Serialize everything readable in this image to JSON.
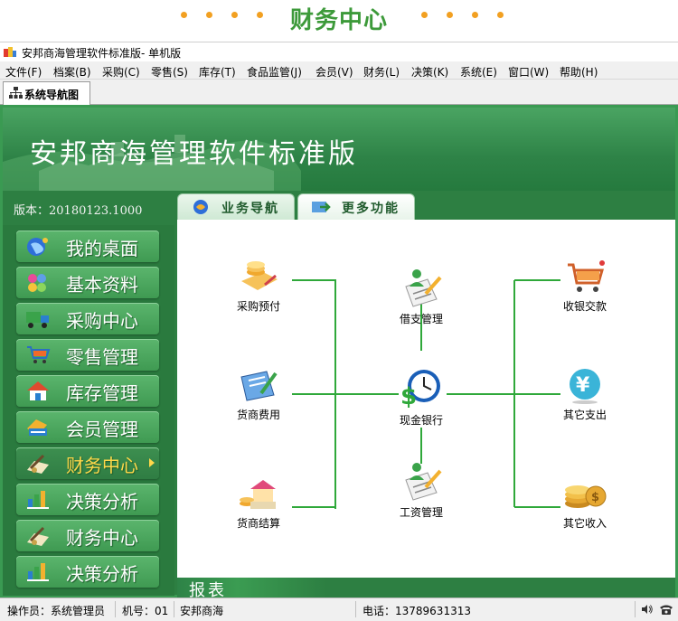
{
  "banner": {
    "title": "财务中心"
  },
  "window": {
    "title": "安邦商海管理软件标准版- 单机版"
  },
  "menu": [
    "文件(F)",
    "档案(B)",
    "采购(C)",
    "零售(S)",
    "库存(T)",
    "食品监管(J)",
    "会员(V)",
    "财务(L)",
    "决策(K)",
    "系统(E)",
    "窗口(W)",
    "帮助(H)"
  ],
  "doc_tab": {
    "label": "系统导航图"
  },
  "hero": {
    "title": "安邦商海管理软件标准版",
    "version": "版本：20180123.1000"
  },
  "side_nav": [
    {
      "label": "我的桌面",
      "icon": "desktop-globe-icon"
    },
    {
      "label": "基本资料",
      "icon": "basic-data-icon"
    },
    {
      "label": "采购中心",
      "icon": "truck-icon"
    },
    {
      "label": "零售管理",
      "icon": "shopping-cart-icon"
    },
    {
      "label": "库存管理",
      "icon": "warehouse-house-icon"
    },
    {
      "label": "会员管理",
      "icon": "member-card-icon"
    },
    {
      "label": "财务中心",
      "icon": "finance-pen-icon",
      "active": true
    },
    {
      "label": "决策分析",
      "icon": "bar-chart-icon"
    },
    {
      "label": "财务中心",
      "icon": "finance-pen-icon"
    },
    {
      "label": "决策分析",
      "icon": "bar-chart-icon"
    }
  ],
  "panel_tabs": [
    {
      "label": "业务导航",
      "icon": "business-nav-icon"
    },
    {
      "label": "更多功能",
      "icon": "more-functions-icon"
    }
  ],
  "flow": {
    "left": [
      {
        "label": "采购预付",
        "icon": "coins-prepay-icon"
      },
      {
        "label": "货商费用",
        "icon": "invoice-pen-icon"
      },
      {
        "label": "货商结算",
        "icon": "house-settle-icon"
      }
    ],
    "center": [
      {
        "label": "借支管理",
        "icon": "user-document-icon"
      },
      {
        "label": "现金银行",
        "icon": "clock-dollar-icon"
      },
      {
        "label": "工资管理",
        "icon": "user-document-icon"
      }
    ],
    "right": [
      {
        "label": "收银交款",
        "icon": "cart-cashier-icon"
      },
      {
        "label": "其它支出",
        "icon": "yen-coin-icon"
      },
      {
        "label": "其它收入",
        "icon": "gold-coins-icon"
      }
    ]
  },
  "report": {
    "label": "报表"
  },
  "status": {
    "operator": "操作员：系统管理员",
    "machine": "机号：01",
    "company": "安邦商海",
    "phone": "电话：13789631313"
  },
  "colors": {
    "brand_green": "#2d7f42",
    "banner_orange": "#f2a021",
    "line_green": "#2fa83a",
    "active_label": "#ffd84a"
  }
}
